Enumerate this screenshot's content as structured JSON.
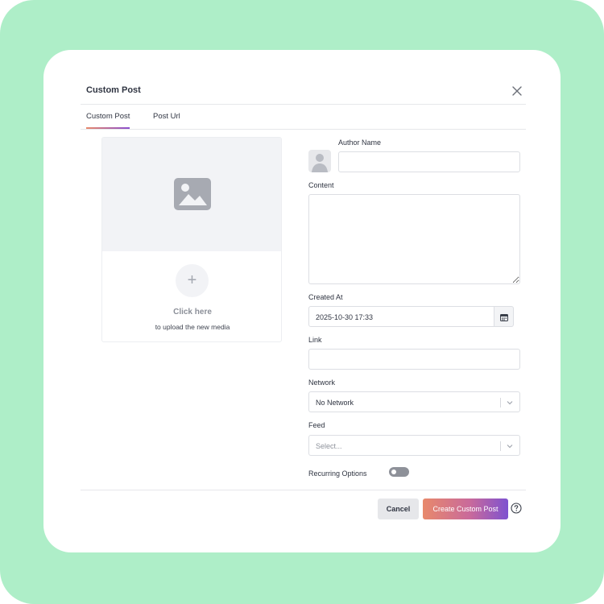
{
  "modal": {
    "title": "Custom Post"
  },
  "tabs": [
    {
      "label": "Custom Post",
      "active": true
    },
    {
      "label": "Post Url",
      "active": false
    }
  ],
  "media": {
    "click_text": "Click here",
    "sub_text": "to upload the new media"
  },
  "form": {
    "author_name_label": "Author Name",
    "author_name_value": "",
    "content_label": "Content",
    "content_value": "",
    "created_at_label": "Created At",
    "created_at_value": "2025-10-30 17:33",
    "link_label": "Link",
    "link_value": "",
    "network_label": "Network",
    "network_value": "No Network",
    "feed_label": "Feed",
    "feed_placeholder": "Select...",
    "recurring_label": "Recurring Options",
    "recurring_enabled": false
  },
  "footer": {
    "cancel_label": "Cancel",
    "create_label": "Create Custom Post"
  },
  "icons": [
    "close-icon",
    "image-icon",
    "plus-icon",
    "calendar-icon",
    "chevron-down-icon",
    "help-icon",
    "avatar-icon"
  ],
  "colors": {
    "backdrop": "#aeeec8",
    "accent_start": "#e8896b",
    "accent_end": "#7e52d0"
  }
}
